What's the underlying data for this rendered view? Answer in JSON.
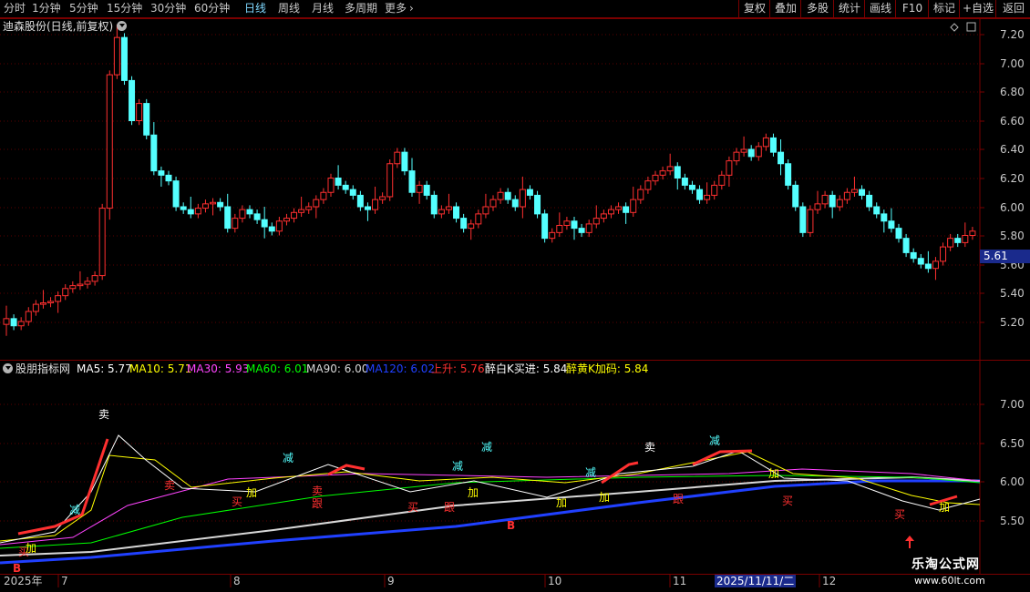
{
  "toolbar": {
    "periods": [
      "分时",
      "1分钟",
      "5分钟",
      "15分钟",
      "30分钟",
      "60分钟",
      "日线",
      "周线",
      "月线",
      "多周期",
      "更多"
    ],
    "right_buttons": [
      "复权",
      "叠加",
      "多股",
      "统计",
      "画线",
      "F10",
      "标记",
      "+自选",
      "返回"
    ]
  },
  "main_pane": {
    "title": "迪森股份(日线,前复权)",
    "y_axis": [
      "7.20",
      "7.00",
      "6.80",
      "6.60",
      "6.40",
      "6.20",
      "6.00",
      "5.80",
      "5.60",
      "5.40",
      "5.20"
    ],
    "last_price": "5.61"
  },
  "indicator_pane": {
    "title": "股朋指标网",
    "items": [
      {
        "text": "MA5: 5.77",
        "color": "#ffffff"
      },
      {
        "text": "MA10: 5.71",
        "color": "#ffff00"
      },
      {
        "text": "MA30: 5.93",
        "color": "#ff44ff"
      },
      {
        "text": "MA60: 6.01",
        "color": "#00ff00"
      },
      {
        "text": "MA90: 6.00",
        "color": "#d8d8d8"
      },
      {
        "text": "MA120: 6.02",
        "color": "#2040ff"
      },
      {
        "text": "上升: 5.76",
        "color": "#ff3030"
      },
      {
        "text": "醉白K买进: 5.84",
        "color": "#ffffff"
      },
      {
        "text": "醉黄K加码: 5.84",
        "color": "#ffff00"
      }
    ],
    "y_axis": [
      "7.00",
      "6.50",
      "6.00",
      "5.50"
    ],
    "signals": [
      "卖",
      "减",
      "买",
      "加",
      "B",
      "卖",
      "减",
      "加",
      "买",
      "跟",
      "减",
      "卖",
      "减",
      "买",
      "加",
      "跟",
      "B",
      "减",
      "加",
      "卖",
      "减",
      "加",
      "跟",
      "买",
      "加",
      "买",
      "加"
    ]
  },
  "date_axis": {
    "labels": [
      "2025年",
      "7",
      "8",
      "9",
      "10",
      "11",
      "12"
    ],
    "highlight": "2025/11/11/二"
  },
  "watermark": {
    "line1": "乐淘公式网",
    "line2": "www.60lt.com"
  },
  "colors": {
    "up": "#ff3030",
    "down": "#54ffff",
    "grid": "#7a0000",
    "tag": "#1a2a8c"
  }
}
